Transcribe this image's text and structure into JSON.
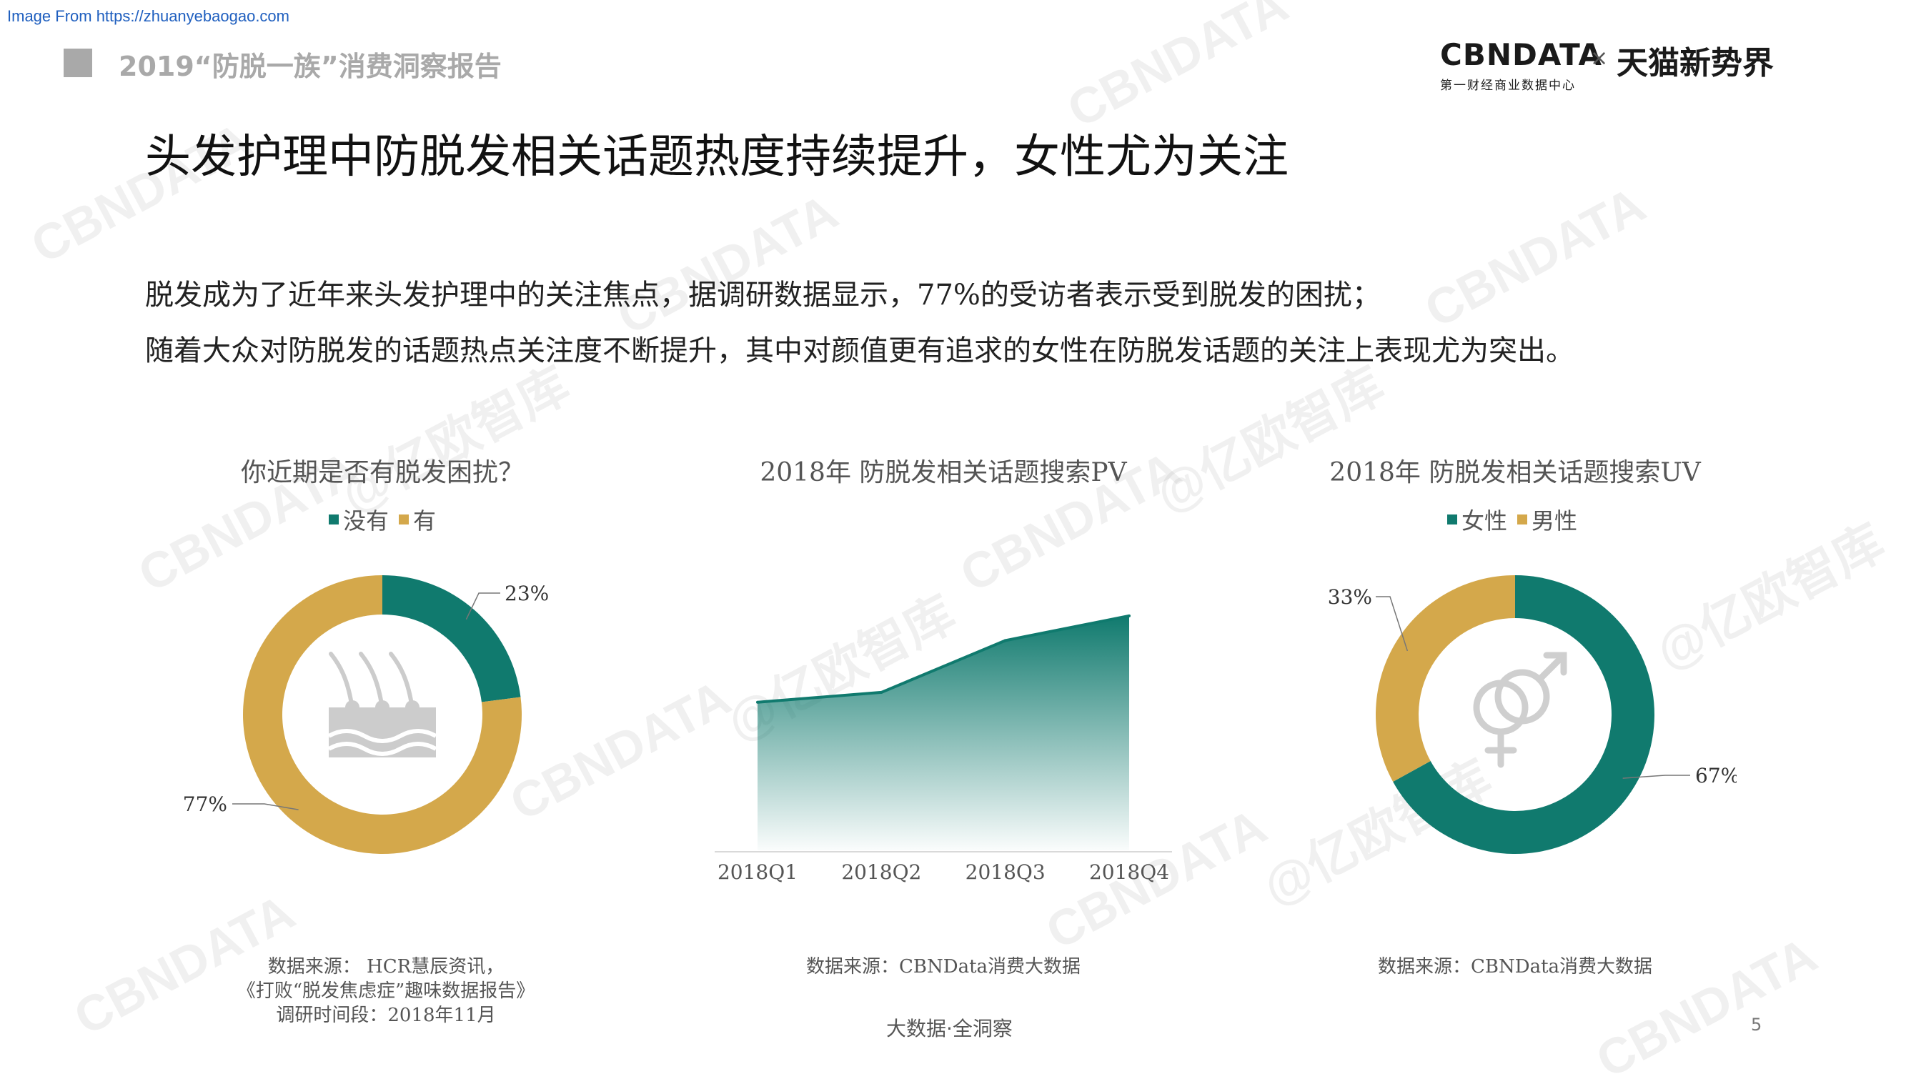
{
  "source_link": "Image From https://zhuanyebaogao.com",
  "header": {
    "report_title": "2019“防脱一族”消费洞察报告",
    "brand_main": "CBNDATA",
    "brand_sub": "第一财经商业数据中心",
    "brand_x": "×",
    "brand_partner": "天猫新势界"
  },
  "main_title": "头发护理中防脱发相关话题热度持续提升，女性尤为关注",
  "paragraph": {
    "line1": "脱发成为了近年来头发护理中的关注焦点，据调研数据显示，77%的受访者表示受到脱发的困扰；",
    "line2": "随着大众对防脱发的话题热点关注度不断提升，其中对颜值更有追求的女性在防脱发话题的关注上表现尤为突出。"
  },
  "colors": {
    "teal": "#107a6e",
    "gold": "#d4a84b",
    "gray_icon": "#cccccc"
  },
  "chart_data": [
    {
      "type": "pie",
      "title": "你近期是否有脱发困扰？",
      "legend": [
        "没有",
        "有"
      ],
      "slices": [
        {
          "label": "没有",
          "value": 23,
          "display": "23%",
          "color": "#107a6e"
        },
        {
          "label": "有",
          "value": 77,
          "display": "77%",
          "color": "#d4a84b"
        }
      ],
      "icon": "hair-follicle-icon",
      "source_lines": [
        "数据来源： HCR慧辰资讯，",
        "《打败“脱发焦虑症”趣味数据报告》",
        "调研时间段：2018年11月"
      ]
    },
    {
      "type": "area",
      "title": "2018年 防脱发相关话题搜索PV",
      "categories": [
        "2018Q1",
        "2018Q2",
        "2018Q3",
        "2018Q4"
      ],
      "values": [
        60,
        64,
        85,
        95
      ],
      "ylim": [
        0,
        110
      ],
      "color": "#107a6e",
      "source_lines": [
        "数据来源：CBNData消费大数据"
      ]
    },
    {
      "type": "pie",
      "title": "2018年 防脱发相关话题搜索UV",
      "legend": [
        "女性",
        "男性"
      ],
      "slices": [
        {
          "label": "女性",
          "value": 67,
          "display": "67%",
          "color": "#107a6e"
        },
        {
          "label": "男性",
          "value": 33,
          "display": "33%",
          "color": "#d4a84b"
        }
      ],
      "icon": "gender-symbols-icon",
      "source_lines": [
        "数据来源：CBNData消费大数据"
      ]
    }
  ],
  "footer": {
    "tagline": "大数据·全洞察",
    "page_number": "5"
  },
  "watermarks": [
    "CBNDATA",
    "@亿欧智库"
  ]
}
